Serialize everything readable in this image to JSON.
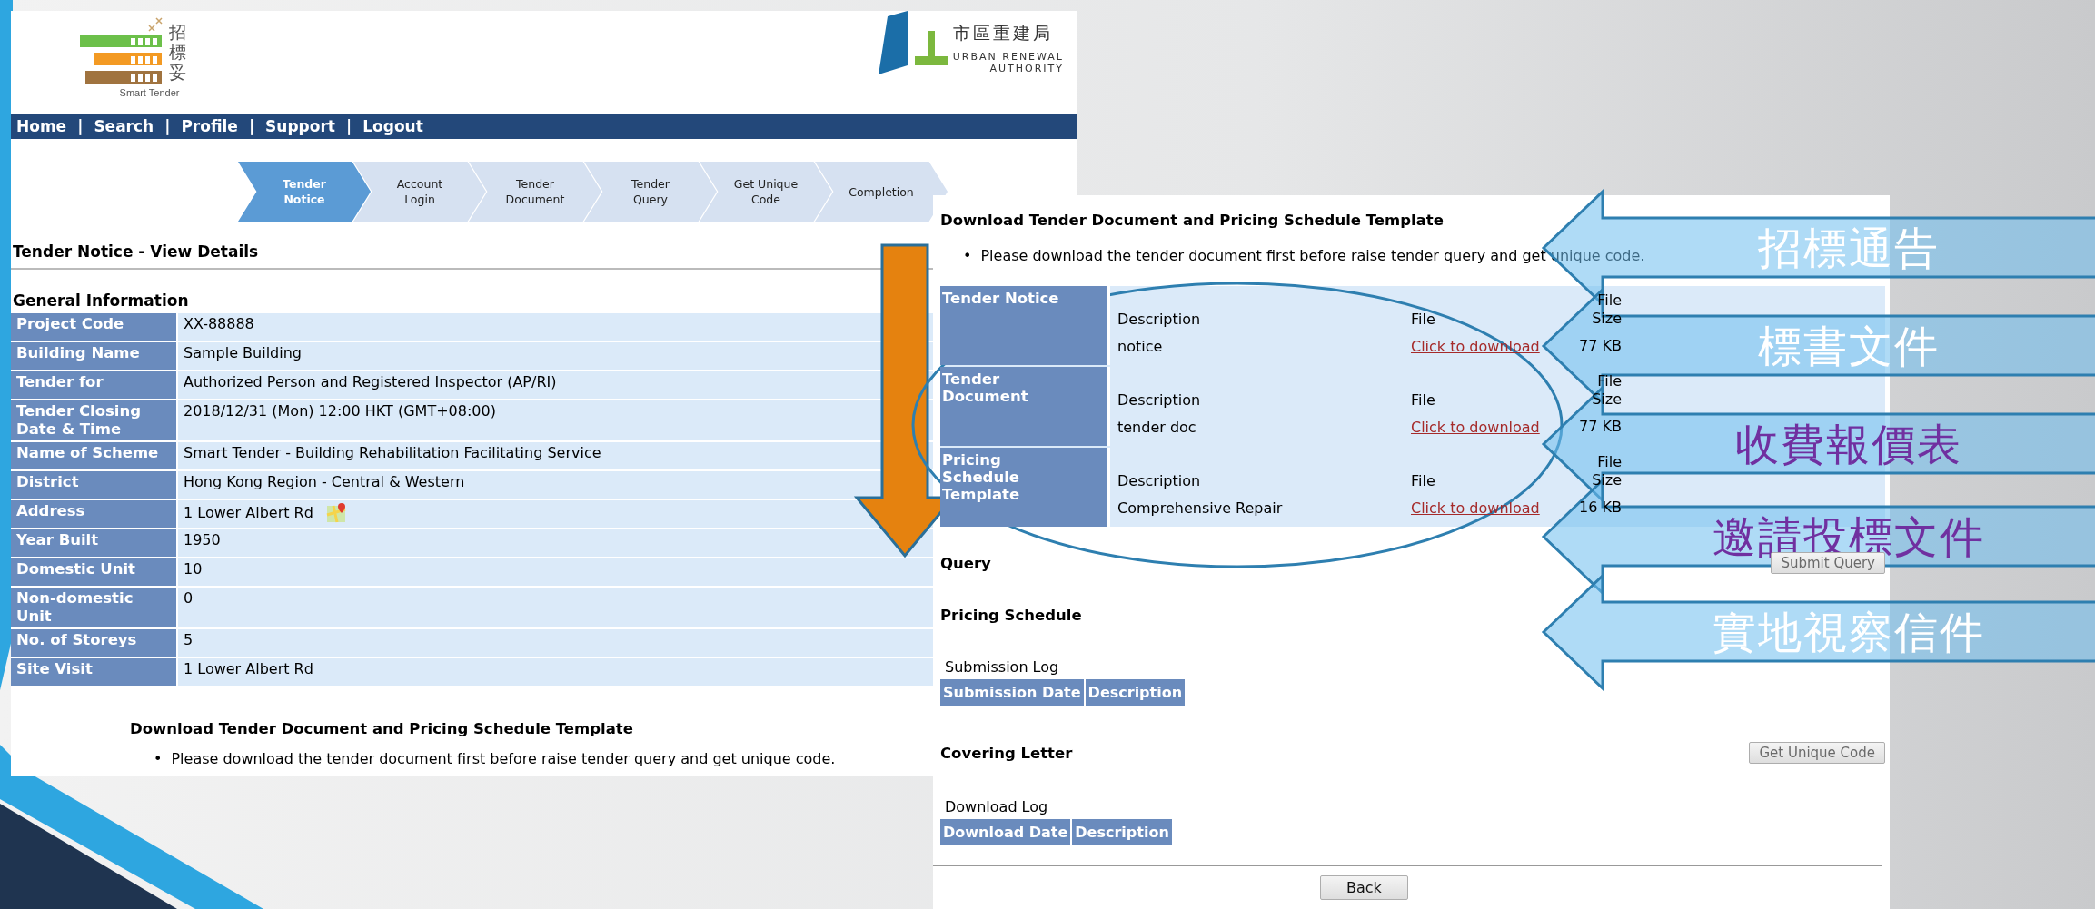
{
  "left_page": {
    "logo": {
      "chinese": [
        "招",
        "標",
        "妥"
      ],
      "english": "Smart Tender"
    },
    "authority_logo": {
      "chinese": "市區重建局",
      "english_line_1": "URBAN RENEWAL",
      "english_line_2": "AUTHORITY"
    },
    "nav": {
      "separator": "|",
      "items": [
        "Home",
        "Search",
        "Profile",
        "Support",
        "Logout"
      ]
    },
    "steps": [
      {
        "lines": [
          "Tender",
          "Notice"
        ],
        "selected": true
      },
      {
        "lines": [
          "Account",
          "Login"
        ],
        "selected": false
      },
      {
        "lines": [
          "Tender",
          "Document"
        ],
        "selected": false
      },
      {
        "lines": [
          "Tender",
          "Query"
        ],
        "selected": false
      },
      {
        "lines": [
          "Get Unique",
          "Code"
        ],
        "selected": false
      },
      {
        "lines": [
          "Completion"
        ],
        "selected": false
      }
    ],
    "title": "Tender Notice - View Details",
    "section_title": "General Information",
    "details": [
      {
        "label": "Project Code",
        "value": "XX-88888",
        "map_link": false
      },
      {
        "label": "Building Name",
        "value": "Sample Building",
        "map_link": false
      },
      {
        "label": "Tender for",
        "value": "Authorized Person and Registered Inspector (AP/RI)",
        "map_link": false
      },
      {
        "label": "Tender Closing Date & Time",
        "value": "2018/12/31 (Mon) 12:00 HKT (GMT+08:00)",
        "map_link": false
      },
      {
        "label": "Name of Scheme",
        "value": "Smart Tender - Building Rehabilitation Facilitating Service",
        "map_link": false
      },
      {
        "label": "District",
        "value": "Hong Kong Region - Central & Western",
        "map_link": false
      },
      {
        "label": "Address",
        "value": "1 Lower Albert Rd",
        "map_link": true
      },
      {
        "label": "Year Built",
        "value": "1950",
        "map_link": false
      },
      {
        "label": "Domestic Unit",
        "value": "10",
        "map_link": false
      },
      {
        "label": "Non-domestic Unit",
        "value": "0",
        "map_link": false
      },
      {
        "label": "No. of Storeys",
        "value": "5",
        "map_link": false
      },
      {
        "label": "Site Visit",
        "value": "1 Lower Albert Rd",
        "map_link": false
      }
    ],
    "download_heading": "Download Tender Document and Pricing Schedule Template",
    "bullet": "•",
    "download_note": "Please download the tender document first before raise tender query and get unique code."
  },
  "right_page": {
    "heading": "Download Tender Document and Pricing Schedule Template",
    "bullet": "•",
    "note": "Please download the tender document first before raise tender query and get unique code.",
    "documents": [
      {
        "category": [
          "Tender Notice"
        ],
        "description_header": "Description",
        "file_header": "File",
        "size_header": [
          "File",
          "Size"
        ],
        "description": "notice",
        "link": "Click to download",
        "size": "77 KB"
      },
      {
        "category": [
          "Tender",
          "Document"
        ],
        "description_header": "Description",
        "file_header": "File",
        "size_header": [
          "File",
          "Size"
        ],
        "description": "tender doc",
        "link": "Click to download",
        "size": "77 KB"
      },
      {
        "category": [
          "Pricing",
          "Schedule",
          "Template"
        ],
        "description_header": "Description",
        "file_header": "File",
        "size_header": [
          "File",
          "Size"
        ],
        "description": "Comprehensive Repair",
        "link": "Click to download",
        "size": "16 KB"
      }
    ],
    "query": {
      "title": "Query",
      "button": "Submit Query"
    },
    "pricing_schedule": {
      "title": "Pricing Schedule",
      "log_title": "Submission Log",
      "log_columns": [
        "Submission Date",
        "Description"
      ]
    },
    "covering_letter": {
      "title": "Covering Letter",
      "button": "Get Unique Code",
      "log_title": "Download Log",
      "log_columns": [
        "Download Date",
        "Description"
      ]
    },
    "back_button": "Back"
  },
  "callouts": [
    {
      "text": "招標通告",
      "color": "#ffffff"
    },
    {
      "text": "標書文件",
      "color": "#ffffff"
    },
    {
      "text": "收費報價表",
      "color": "#7030a0"
    },
    {
      "text": "邀請投標文件",
      "color": "#7030a0"
    },
    {
      "text": "實地視察信件",
      "color": "#ffffff"
    }
  ]
}
